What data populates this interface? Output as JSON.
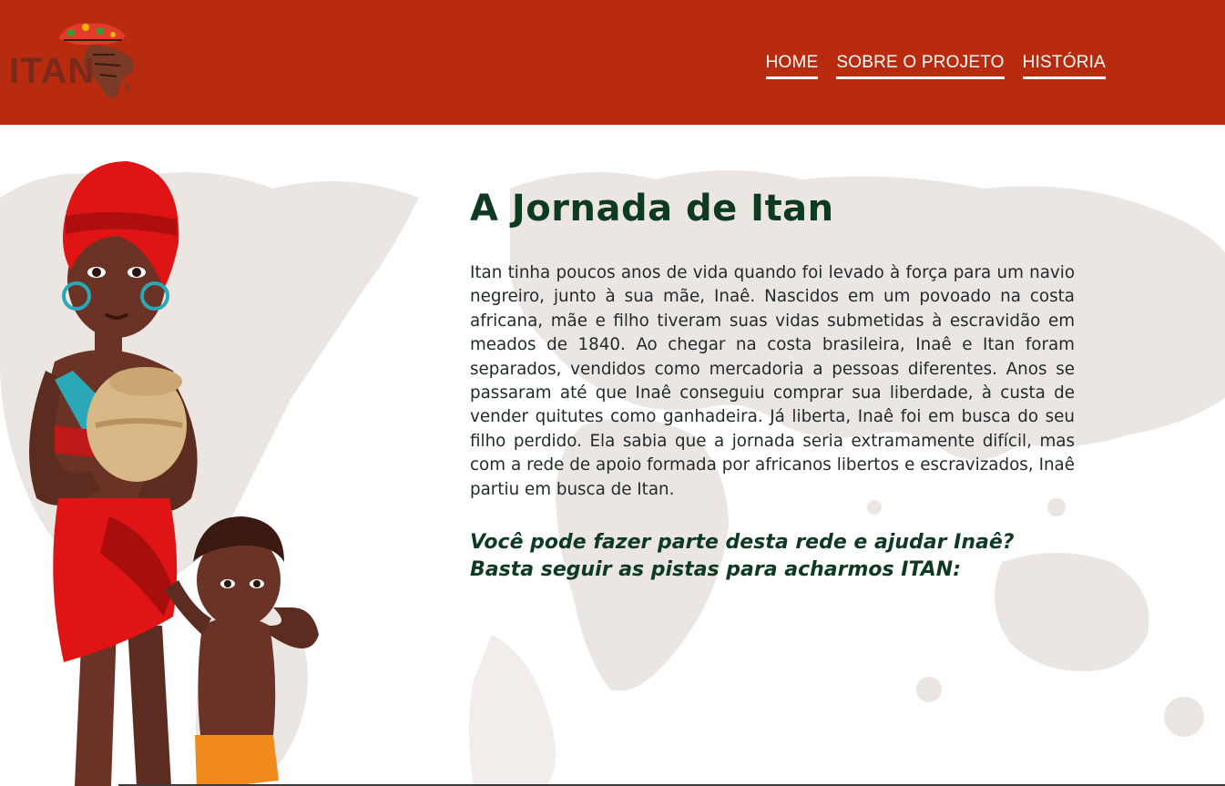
{
  "header": {
    "logo_text": "ITAN",
    "nav": [
      {
        "label": "HOME"
      },
      {
        "label": "SOBRE O PROJETO"
      },
      {
        "label": "HISTÓRIA"
      }
    ]
  },
  "main": {
    "title": "A Jornada de Itan",
    "story": "Itan tinha poucos anos de vida quando foi levado à força para um navio negreiro, junto à sua mãe, Inaê. Nascidos em um povoado na costa africana, mãe e filho tiveram suas vidas submetidas à escravidão em meados de 1840. Ao chegar na costa brasileira, Inaê e Itan foram separados, vendidos como mercadoria a pessoas diferentes. Anos se passaram até que Inaê conseguiu comprar sua liberdade, à custa de vender quitutes como ganhadeira. Já liberta, Inaê foi em busca do seu filho perdido. Ela sabia que a jornada seria extramamente difícil, mas com a rede de apoio formada por africanos libertos e escravizados, Inaê partiu em busca de Itan.",
    "cta": "Você pode fazer parte desta rede e ajudar Inaê? Basta seguir as pistas para acharmos ITAN:"
  },
  "colors": {
    "header_bg": "#b82b0e",
    "title": "#0e3a22",
    "map": "#ece6e3"
  },
  "icons": [
    "itan-logo",
    "world-map",
    "mother-and-child-illustration"
  ]
}
